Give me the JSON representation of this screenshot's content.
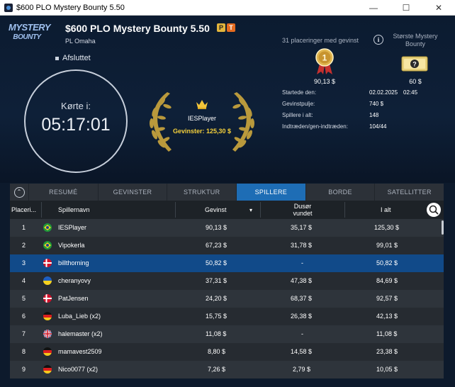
{
  "window": {
    "title": "$600 PLO Mystery Bounty 5.50",
    "minimize": "—",
    "maximize": "☐",
    "close": "✕"
  },
  "header": {
    "logo_line1": "MYSTERY",
    "logo_line2": "BOUNTY",
    "tournament_name": "$600 PLO Mystery Bounty 5.50",
    "badge_pot": "P",
    "badge_t": "T",
    "game_type": "PL Omaha",
    "status": "Afsluttet",
    "clock_label": "Kørte i:",
    "clock_time": "05:17:01",
    "winner_name": "IESPlayer",
    "winner_prize": "Gevinster: 125,30 $"
  },
  "prizes": {
    "places_label": "31 placeringer med gevinst",
    "first_medal_text": "1",
    "first_prize": "90,13 $",
    "biggest_bounty_label": "Største Mystery Bounty",
    "biggest_bounty_value": "60 $"
  },
  "info": {
    "started_label": "Startede den:",
    "started_date": "02.02.2025",
    "started_time": "02:45",
    "pool_label": "Gevinstpulje:",
    "pool_value": "740 $",
    "players_label": "Spillere i alt:",
    "players_value": "148",
    "entries_label": "Indtræden/gen-indtræden:",
    "entries_value": "104/44"
  },
  "tabs": [
    {
      "label": "RESUMÉ",
      "active": false
    },
    {
      "label": "GEVINSTER",
      "active": false
    },
    {
      "label": "STRUKTUR",
      "active": false
    },
    {
      "label": "SPILLERE",
      "active": true
    },
    {
      "label": "BORDE",
      "active": false
    },
    {
      "label": "SATELLITTER",
      "active": false
    }
  ],
  "table": {
    "col_place": "Placeri...",
    "col_name": "Spillernavn",
    "col_prize": "Gevinst",
    "sort_arrow": "▾",
    "col_bounty_l1": "Dusør",
    "col_bounty_l2": "vundet",
    "col_total": "I alt",
    "rows": [
      {
        "place": "1",
        "flag": "brazil",
        "name": "IESPlayer",
        "prize": "90,13 $",
        "bounty": "35,17 $",
        "total": "125,30 $"
      },
      {
        "place": "2",
        "flag": "brazil",
        "name": "Vipokerla",
        "prize": "67,23 $",
        "bounty": "31,78 $",
        "total": "99,01 $"
      },
      {
        "place": "3",
        "flag": "denmark",
        "name": "billthorning",
        "prize": "50,82 $",
        "bounty": "-",
        "total": "50,82 $",
        "selected": true
      },
      {
        "place": "4",
        "flag": "ukraine",
        "name": "cheranyovy",
        "prize": "37,31 $",
        "bounty": "47,38 $",
        "total": "84,69 $"
      },
      {
        "place": "5",
        "flag": "denmark",
        "name": "PatJensen",
        "prize": "24,20 $",
        "bounty": "68,37 $",
        "total": "92,57 $"
      },
      {
        "place": "6",
        "flag": "germany",
        "name": "Luba_Lieb (x2)",
        "prize": "15,75 $",
        "bounty": "26,38 $",
        "total": "42,13 $"
      },
      {
        "place": "7",
        "flag": "uk",
        "name": "halemaster (x2)",
        "prize": "11,08 $",
        "bounty": "-",
        "total": "11,08 $"
      },
      {
        "place": "8",
        "flag": "germany",
        "name": "mamavest2509",
        "prize": "8,80 $",
        "bounty": "14,58 $",
        "total": "23,38 $"
      },
      {
        "place": "9",
        "flag": "germany",
        "name": "Nico0077 (x2)",
        "prize": "7,26 $",
        "bounty": "2,79 $",
        "total": "10,05 $"
      }
    ]
  },
  "colors": {
    "accent": "#1e6db5",
    "selected_row": "#114a89",
    "gold": "#f5d03b"
  }
}
